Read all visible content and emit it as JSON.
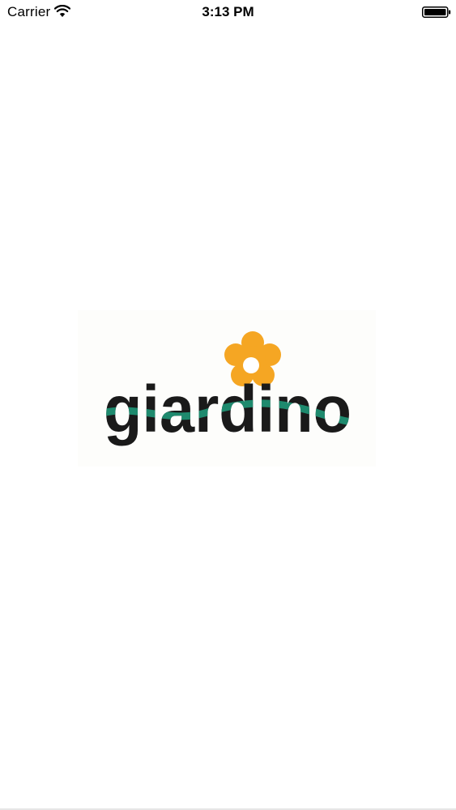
{
  "status_bar": {
    "carrier": "Carrier",
    "time": "3:13 PM",
    "wifi_icon": "wifi-icon",
    "battery_icon": "battery-icon"
  },
  "logo": {
    "wordmark": "giardino",
    "icon": "flower-icon",
    "colors": {
      "text": "#1a1a1a",
      "wave": "#1e8a6e",
      "petals": "#f5a623",
      "flower_center": "#ffffff"
    }
  }
}
